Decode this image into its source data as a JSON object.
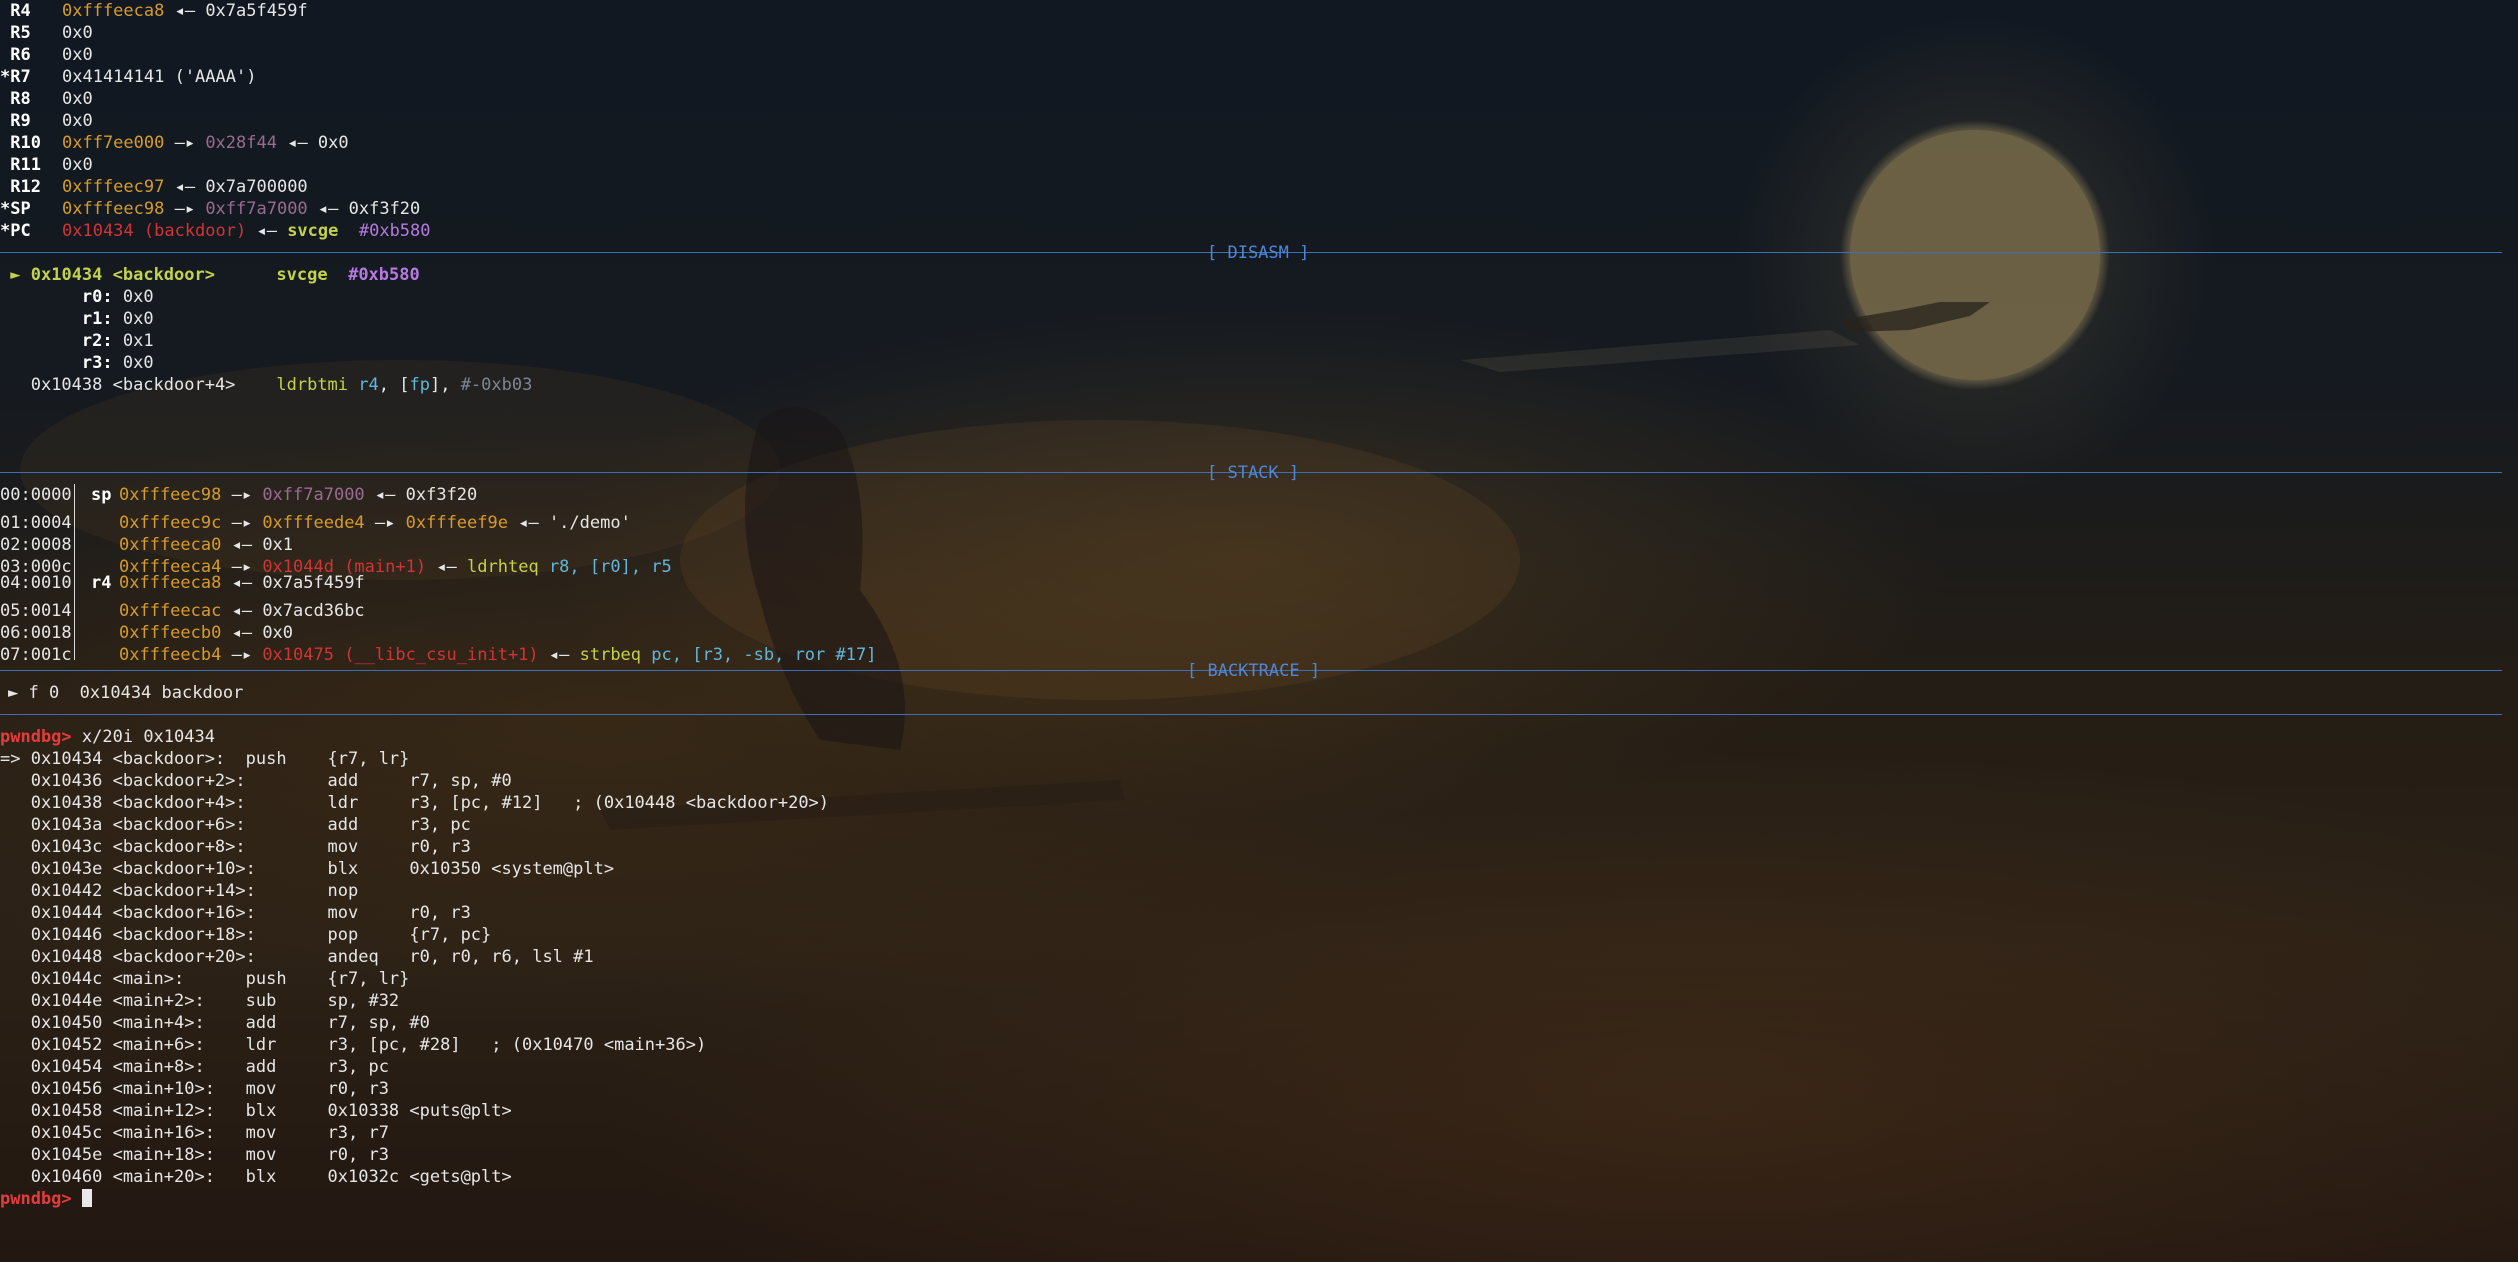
{
  "registers": [
    {
      "mark": " ",
      "name": "R4",
      "a": "0xfffeeca8",
      "b": "0x7a5f459f"
    },
    {
      "mark": " ",
      "name": "R5",
      "v": "0x0"
    },
    {
      "mark": " ",
      "name": "R6",
      "v": "0x0"
    },
    {
      "mark": "*",
      "name": "R7",
      "v": "0x41414141 ('AAAA')"
    },
    {
      "mark": " ",
      "name": "R8",
      "v": "0x0"
    },
    {
      "mark": " ",
      "name": "R9",
      "v": "0x0"
    },
    {
      "mark": " ",
      "name": "R10",
      "a": "0xff7ee000",
      "b": "0x28f44",
      "c": "0x0"
    },
    {
      "mark": " ",
      "name": "R11",
      "v": "0x0"
    },
    {
      "mark": " ",
      "name": "R12",
      "a": "0xfffeec97",
      "b": "0x7a700000"
    },
    {
      "mark": "*",
      "name": "SP",
      "a": "0xfffeec98",
      "b": "0xff7a7000",
      "c": "0xf3f20"
    },
    {
      "mark": "*",
      "name": "PC",
      "a": "0x10434 (backdoor)",
      "op": "svcge",
      "arg": "#0xb580"
    }
  ],
  "sections": {
    "disasm": "[ DISASM ]",
    "stack": "[ STACK ]",
    "backtrace": "[ BACKTRACE ]"
  },
  "disasm": {
    "current_addr": "0x10434 <backdoor>",
    "current_op": "svcge",
    "current_arg": "#0xb580",
    "args": [
      {
        "name": "r0:",
        "val": "0x0"
      },
      {
        "name": "r1:",
        "val": "0x0"
      },
      {
        "name": "r2:",
        "val": "0x1"
      },
      {
        "name": "r3:",
        "val": "0x0"
      }
    ],
    "next_addr": "0x10438 <backdoor+4>",
    "next_op": "ldrbtmi",
    "next_r4": "r4",
    "next_fp": "fp",
    "next_imm": "#-0xb03"
  },
  "stack": [
    {
      "off": "00:0000",
      "reg": "sp",
      "a": "0xfffeec98",
      "b": "0xff7a7000",
      "c": "0xf3f20"
    },
    {
      "off": "01:0004",
      "reg": "",
      "a": "0xfffeec9c",
      "b": "0xfffeede4",
      "b2": "0xfffeef9e",
      "c": "'./demo'"
    },
    {
      "off": "02:0008",
      "reg": "",
      "a": "0xfffeeca0",
      "c": "0x1"
    },
    {
      "off": "03:000c",
      "reg": "",
      "a": "0xfffeeca4",
      "b": "0x1044d (main+1)",
      "op": "ldrhteq",
      "ops": "r8, [r0], r5"
    },
    {
      "off": "04:0010",
      "reg": "r4",
      "a": "0xfffeeca8",
      "c": "0x7a5f459f"
    },
    {
      "off": "05:0014",
      "reg": "",
      "a": "0xfffeecac",
      "c": "0x7acd36bc"
    },
    {
      "off": "06:0018",
      "reg": "",
      "a": "0xfffeecb0",
      "c": "0x0"
    },
    {
      "off": "07:001c",
      "reg": "",
      "a": "0xfffeecb4",
      "b": "0x10475 (__libc_csu_init+1)",
      "op": "strbeq",
      "ops": "pc, [r3, -sb, ror #17]"
    }
  ],
  "backtrace": "► f 0  0x10434 backdoor",
  "prompt": "pwndbg>",
  "command": "x/20i 0x10434",
  "listing": [
    "=> 0x10434 <backdoor>:  push    {r7, lr}",
    "   0x10436 <backdoor+2>:        add     r7, sp, #0",
    "   0x10438 <backdoor+4>:        ldr     r3, [pc, #12]   ; (0x10448 <backdoor+20>)",
    "   0x1043a <backdoor+6>:        add     r3, pc",
    "   0x1043c <backdoor+8>:        mov     r0, r3",
    "   0x1043e <backdoor+10>:       blx     0x10350 <system@plt>",
    "   0x10442 <backdoor+14>:       nop",
    "   0x10444 <backdoor+16>:       mov     r0, r3",
    "   0x10446 <backdoor+18>:       pop     {r7, pc}",
    "   0x10448 <backdoor+20>:       andeq   r0, r0, r6, lsl #1",
    "   0x1044c <main>:      push    {r7, lr}",
    "   0x1044e <main+2>:    sub     sp, #32",
    "   0x10450 <main+4>:    add     r7, sp, #0",
    "   0x10452 <main+6>:    ldr     r3, [pc, #28]   ; (0x10470 <main+36>)",
    "   0x10454 <main+8>:    add     r3, pc",
    "   0x10456 <main+10>:   mov     r0, r3",
    "   0x10458 <main+12>:   blx     0x10338 <puts@plt>",
    "   0x1045c <main+16>:   mov     r3, r7",
    "   0x1045e <main+18>:   mov     r0, r3",
    "   0x10460 <main+20>:   blx     0x1032c <gets@plt>"
  ]
}
